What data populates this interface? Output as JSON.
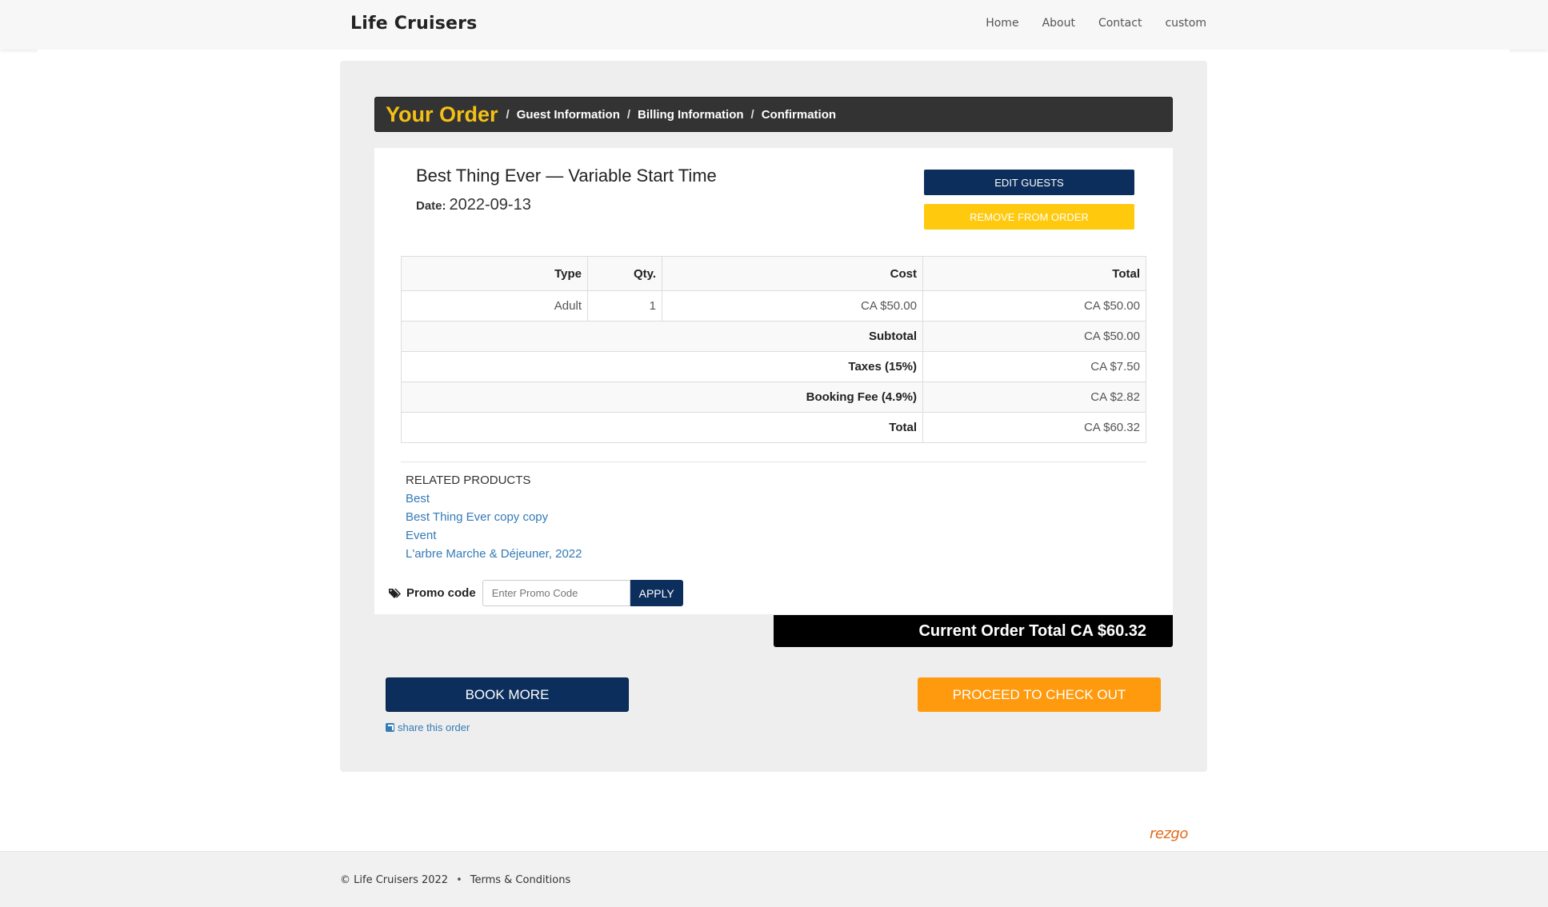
{
  "header": {
    "brand": "Life Cruisers",
    "nav": [
      "Home",
      "About",
      "Contact",
      "custom"
    ]
  },
  "steps": {
    "current": "Your Order",
    "others": [
      "Guest Information",
      "Billing Information",
      "Confirmation"
    ]
  },
  "item": {
    "title": "Best Thing Ever — Variable Start Time",
    "date_label": "Date:",
    "date": "2022-09-13",
    "edit_label": "EDIT GUESTS",
    "remove_label": "REMOVE FROM ORDER"
  },
  "table": {
    "headers": [
      "Type",
      "Qty.",
      "Cost",
      "Total"
    ],
    "line": {
      "type": "Adult",
      "qty": "1",
      "cost": "CA $50.00",
      "total": "CA $50.00"
    },
    "subtotal_label": "Subtotal",
    "subtotal": "CA $50.00",
    "taxes_label": "Taxes (15%)",
    "taxes": "CA $7.50",
    "fee_label": "Booking Fee (4.9%)",
    "fee": "CA $2.82",
    "total_label": "Total",
    "total": "CA $60.32"
  },
  "related": {
    "heading": "RELATED PRODUCTS",
    "items": [
      "Best",
      "Best Thing Ever copy copy",
      "Event",
      "L'arbre Marche & Déjeuner, 2022"
    ]
  },
  "promo": {
    "label": "Promo code",
    "placeholder": "Enter Promo Code",
    "apply_label": "APPLY"
  },
  "order_total": "Current Order Total CA $60.32",
  "actions": {
    "book_more": "BOOK MORE",
    "checkout": "PROCEED TO CHECK OUT",
    "share": "share this order"
  },
  "powered_by": "rezgo",
  "footer": {
    "copyright": "© Life Cruisers 2022",
    "separator": "•",
    "terms": "Terms & Conditions"
  },
  "colors": {
    "navy": "#0c2e5c",
    "yellow": "#ffc90e",
    "orange": "#ff9a0e",
    "step_accent": "#f5c016",
    "link": "#337ab7"
  }
}
